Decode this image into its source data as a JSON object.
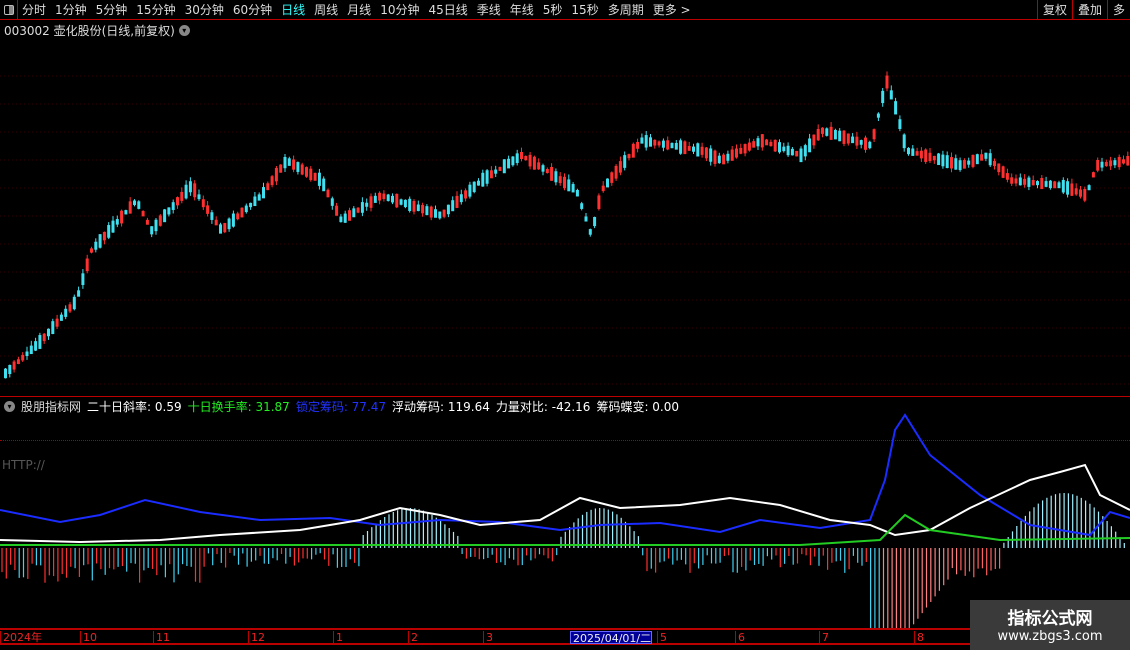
{
  "toolbar": {
    "periods": [
      "分时",
      "1分钟",
      "5分钟",
      "15分钟",
      "30分钟",
      "60分钟",
      "日线",
      "周线",
      "月线",
      "10分钟",
      "45日线",
      "季线",
      "年线",
      "5秒",
      "15秒",
      "多周期",
      "更多 >"
    ],
    "active": "日线",
    "right_buttons": [
      "复权",
      "叠加",
      "多"
    ]
  },
  "stock": {
    "title": "003002 壶化股份(日线,前复权)"
  },
  "indicator": {
    "name": "股朋指标网",
    "items": [
      {
        "label": "二十日斜率: 0.59",
        "color": "#ffffff"
      },
      {
        "label": "十日换手率: 31.87",
        "color": "#22ee22"
      },
      {
        "label": "锁定筹码: 77.47",
        "color": "#2233ff"
      },
      {
        "label": "浮动筹码: 119.64",
        "color": "#ffffff"
      },
      {
        "label": "力量对比: -42.16",
        "color": "#ffffff"
      },
      {
        "label": "筹码蝶变: 0.00",
        "color": "#ffffff"
      }
    ],
    "http": "HTTP://"
  },
  "axis": {
    "ticks": [
      "2024年",
      "10",
      "11",
      "12",
      "1",
      "2",
      "3",
      "2025/04/01/二",
      "5",
      "6",
      "7",
      "8"
    ]
  },
  "watermark": {
    "title": "指标公式网",
    "url": "www.zbgs3.com"
  },
  "colors": {
    "up": "#ff3030",
    "down": "#40e0f0",
    "border": "#bb0000"
  }
}
